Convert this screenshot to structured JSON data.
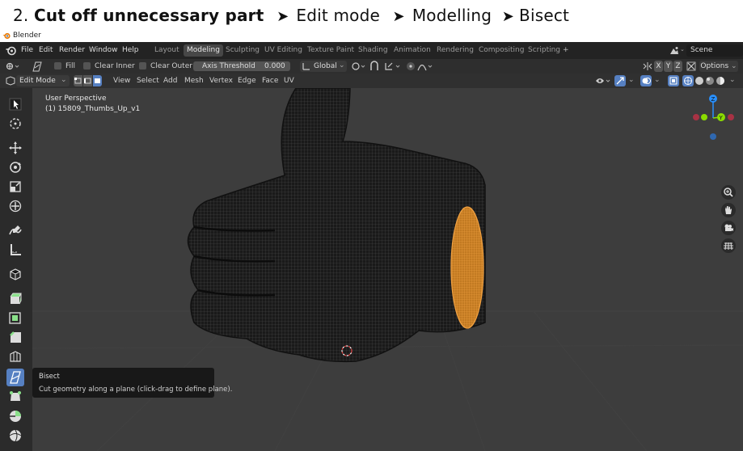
{
  "caption": {
    "number": "2.",
    "bold": "Cut off unnecessary part",
    "step1": "Edit mode",
    "step2": "Modelling",
    "step3": "Bisect",
    "arrow": "➤"
  },
  "window": {
    "title": "Blender"
  },
  "menu": [
    "File",
    "Edit",
    "Render",
    "Window",
    "Help"
  ],
  "workspaces": [
    "Layout",
    "Modeling",
    "Sculpting",
    "UV Editing",
    "Texture Paint",
    "Shading",
    "Animation",
    "Rendering",
    "Compositing",
    "Scripting"
  ],
  "workspace_add": "+",
  "scene_label": "Scene",
  "tool_settings": {
    "fill_label": "Fill",
    "clear_inner_label": "Clear Inner",
    "clear_outer_label": "Clear Outer",
    "axis_threshold_label": "Axis Threshold",
    "axis_threshold_value": "0.000",
    "orientation_value": "Global",
    "axes": [
      "X",
      "Y",
      "Z"
    ],
    "options_label": "Options"
  },
  "editor_header": {
    "mode_value": "Edit Mode",
    "menus": [
      "View",
      "Select",
      "Add",
      "Mesh",
      "Vertex",
      "Edge",
      "Face",
      "UV"
    ]
  },
  "viewport": {
    "perspective_label": "User Perspective",
    "object_label": "(1) 15809_Thumbs_Up_v1",
    "gizmo_z": "Z",
    "gizmo_y": "Y"
  },
  "tooltip": {
    "title": "Bisect",
    "description": "Cut geometry along a plane (click-drag to define plane)."
  },
  "colors": {
    "accent": "#5680c2",
    "active_workspace": "#474747",
    "selected_faces": "#e8952e",
    "axis_x": "#ff3352",
    "axis_y": "#8bdc00",
    "axis_z": "#2890ff"
  }
}
